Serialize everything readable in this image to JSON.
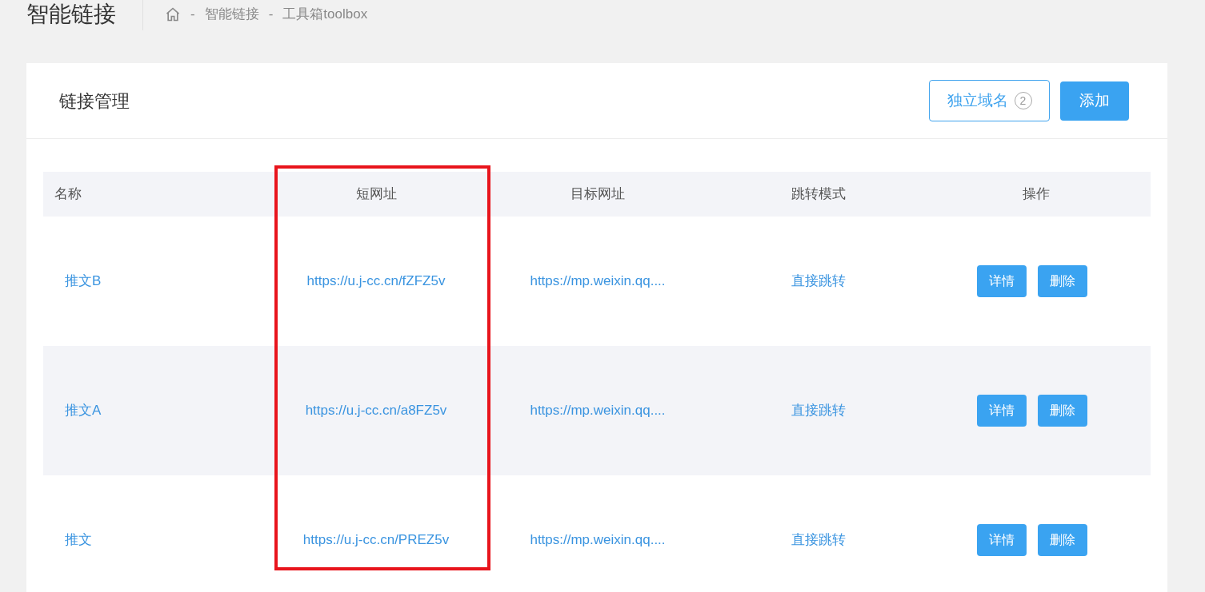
{
  "page_title": "智能链接",
  "breadcrumb_separator": "-",
  "breadcrumb": [
    "智能链接",
    "工具箱toolbox"
  ],
  "card": {
    "title": "链接管理",
    "buttons": [
      {
        "kind": "outline",
        "label": "独立域名",
        "count": "2"
      },
      {
        "kind": "primary",
        "label": "添加"
      }
    ]
  },
  "table": {
    "columns": [
      "名称",
      "短网址",
      "目标网址",
      "跳转模式",
      "操作"
    ],
    "rows": [
      {
        "name": "推文B",
        "short_url": "https://u.j-cc.cn/fZFZ5v",
        "target_url": "https://mp.weixin.qq....",
        "mode": "直接跳转",
        "actions": [
          "详情",
          "删除"
        ]
      },
      {
        "name": "推文A",
        "short_url": "https://u.j-cc.cn/a8FZ5v",
        "target_url": "https://mp.weixin.qq....",
        "mode": "直接跳转",
        "actions": [
          "详情",
          "删除"
        ]
      },
      {
        "name": "推文",
        "short_url": "https://u.j-cc.cn/PREZ5v",
        "target_url": "https://mp.weixin.qq....",
        "mode": "直接跳转",
        "actions": [
          "详情",
          "删除"
        ]
      }
    ]
  },
  "annotation": {
    "kind": "box",
    "color": "#e8141c"
  }
}
